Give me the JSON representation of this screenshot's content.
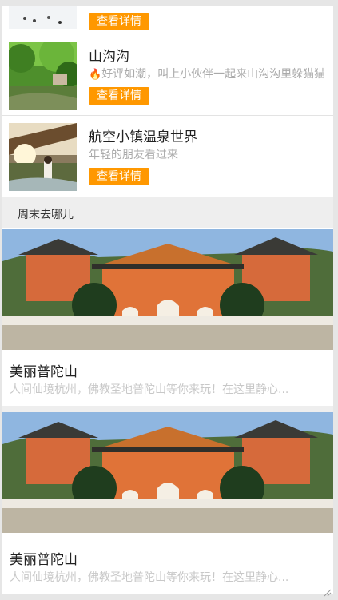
{
  "attractions": [
    {
      "title": "",
      "description": "",
      "button_label": "查看详情"
    },
    {
      "title": "山沟沟",
      "description": "好评如潮，叫上小伙伴一起来山沟沟里躲猫猫",
      "description_icon": "fire-icon",
      "button_label": "查看详情"
    },
    {
      "title": "航空小镇温泉世界",
      "description": "年轻的朋友看过来",
      "button_label": "查看详情"
    }
  ],
  "weekend_section": {
    "title": "周末去哪儿",
    "cards": [
      {
        "title": "美丽普陀山",
        "description": "人间仙境杭州，佛教圣地普陀山等你来玩！在这里静心..."
      },
      {
        "title": "美丽普陀山",
        "description": "人间仙境杭州，佛教圣地普陀山等你来玩！在这里静心..."
      }
    ]
  },
  "colors": {
    "accent": "#ff9800",
    "section_bg": "#eeeeee",
    "muted_text": "#aaaaaa"
  }
}
